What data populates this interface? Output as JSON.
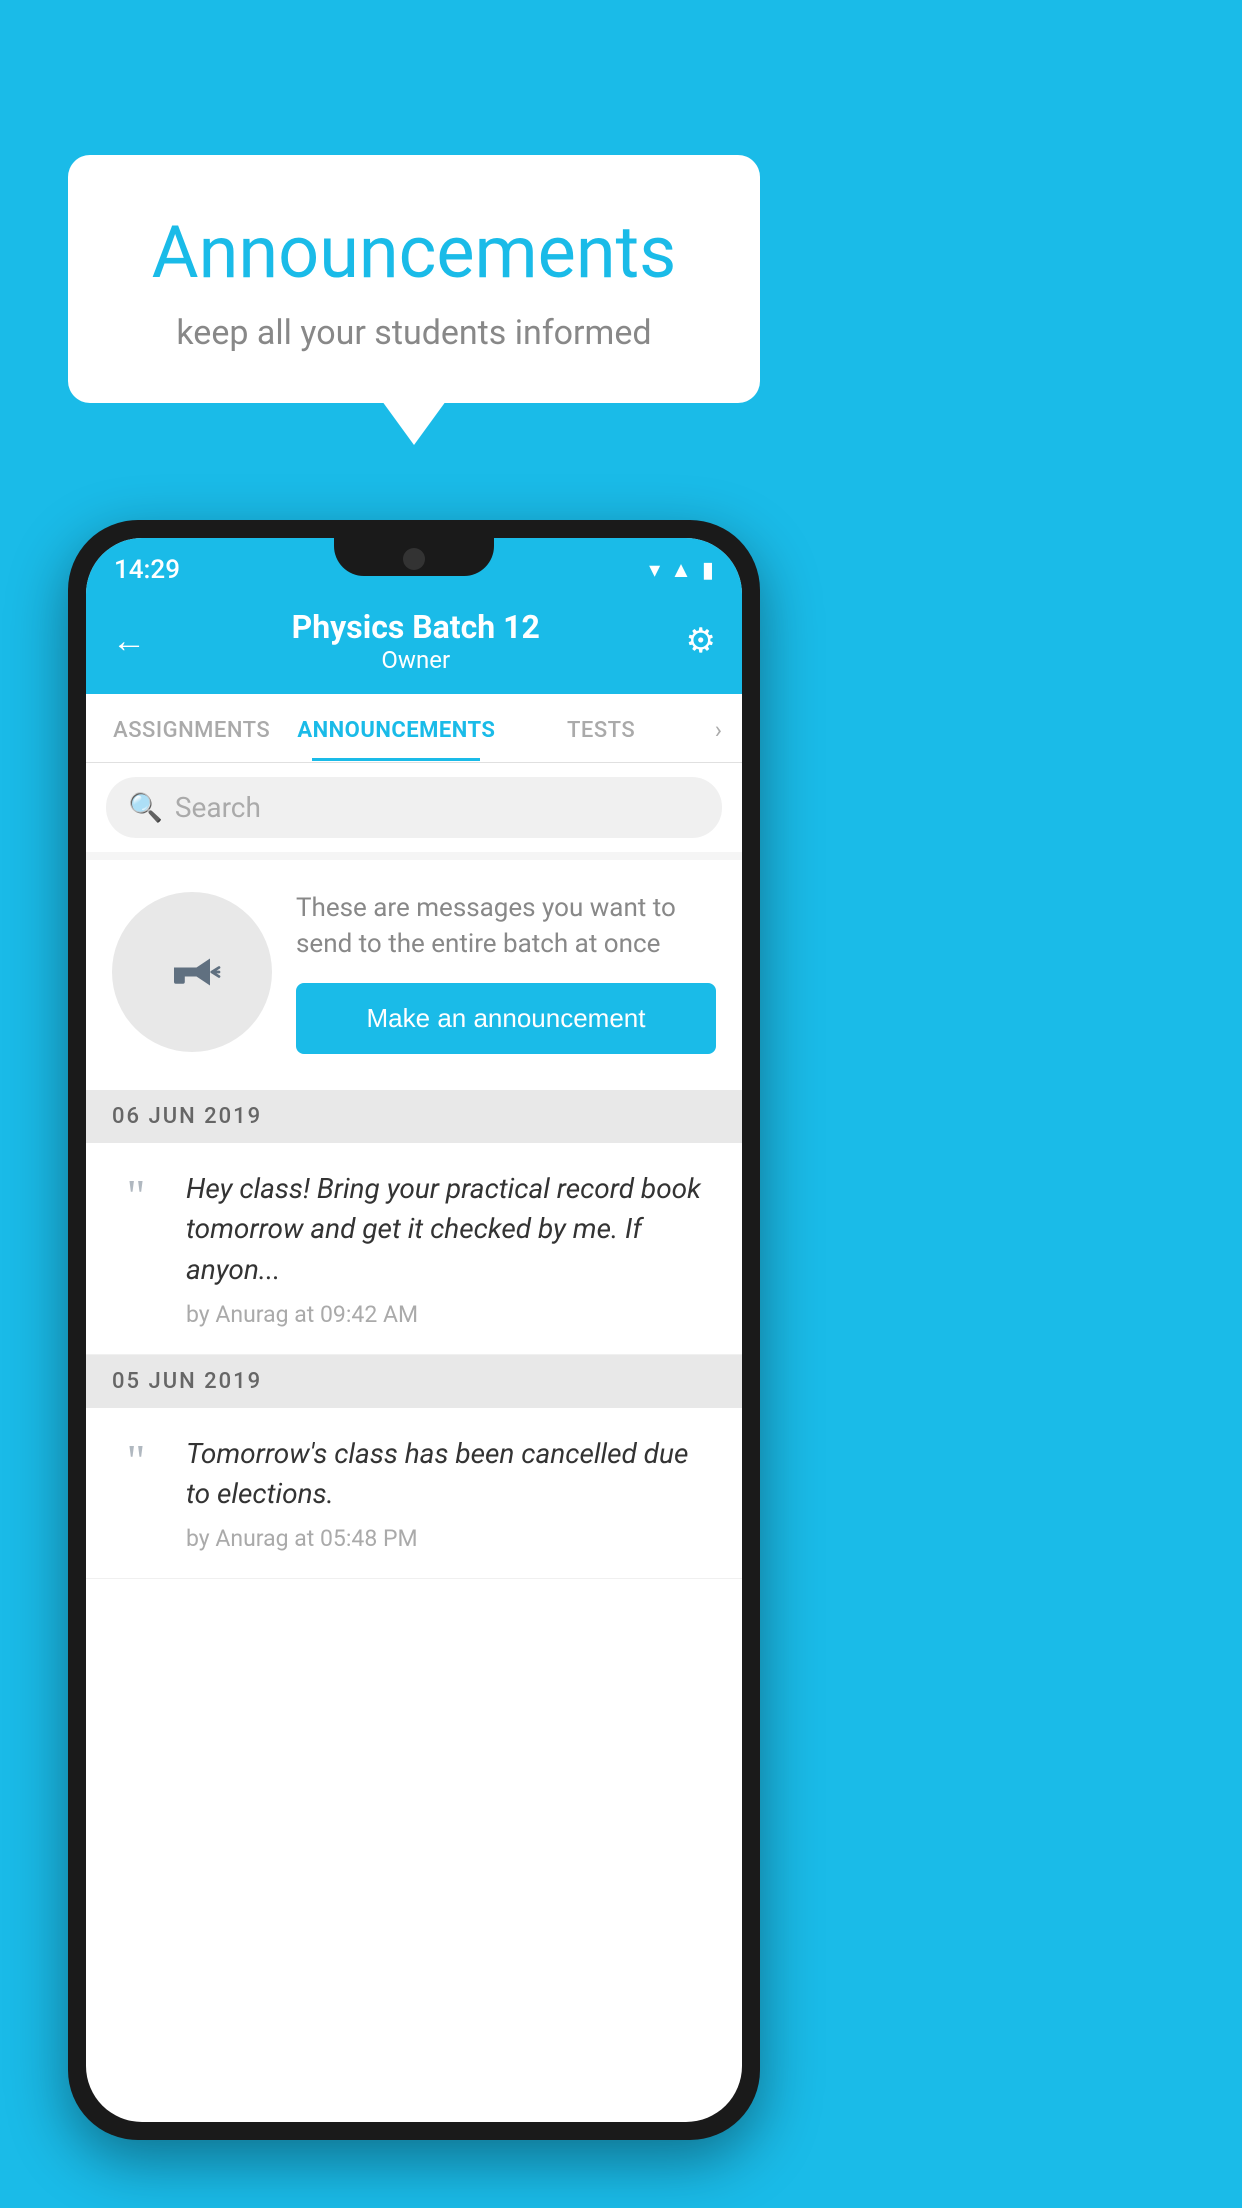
{
  "background_color": "#1ABBE8",
  "speech_bubble": {
    "title": "Announcements",
    "subtitle": "keep all your students informed"
  },
  "status_bar": {
    "time": "14:29",
    "icons": [
      "wifi",
      "signal",
      "battery"
    ]
  },
  "header": {
    "title": "Physics Batch 12",
    "subtitle": "Owner",
    "back_label": "←",
    "settings_label": "⚙"
  },
  "tabs": [
    {
      "label": "ASSIGNMENTS",
      "active": false
    },
    {
      "label": "ANNOUNCEMENTS",
      "active": true
    },
    {
      "label": "TESTS",
      "active": false
    }
  ],
  "search": {
    "placeholder": "Search"
  },
  "promo": {
    "description": "These are messages you want to send to the entire batch at once",
    "button_label": "Make an announcement"
  },
  "announcements": [
    {
      "date": "06  JUN  2019",
      "text": "Hey class! Bring your practical record book tomorrow and get it checked by me. If anyon...",
      "meta": "by Anurag at 09:42 AM"
    },
    {
      "date": "05  JUN  2019",
      "text": "Tomorrow's class has been cancelled due to elections.",
      "meta": "by Anurag at 05:48 PM"
    }
  ]
}
